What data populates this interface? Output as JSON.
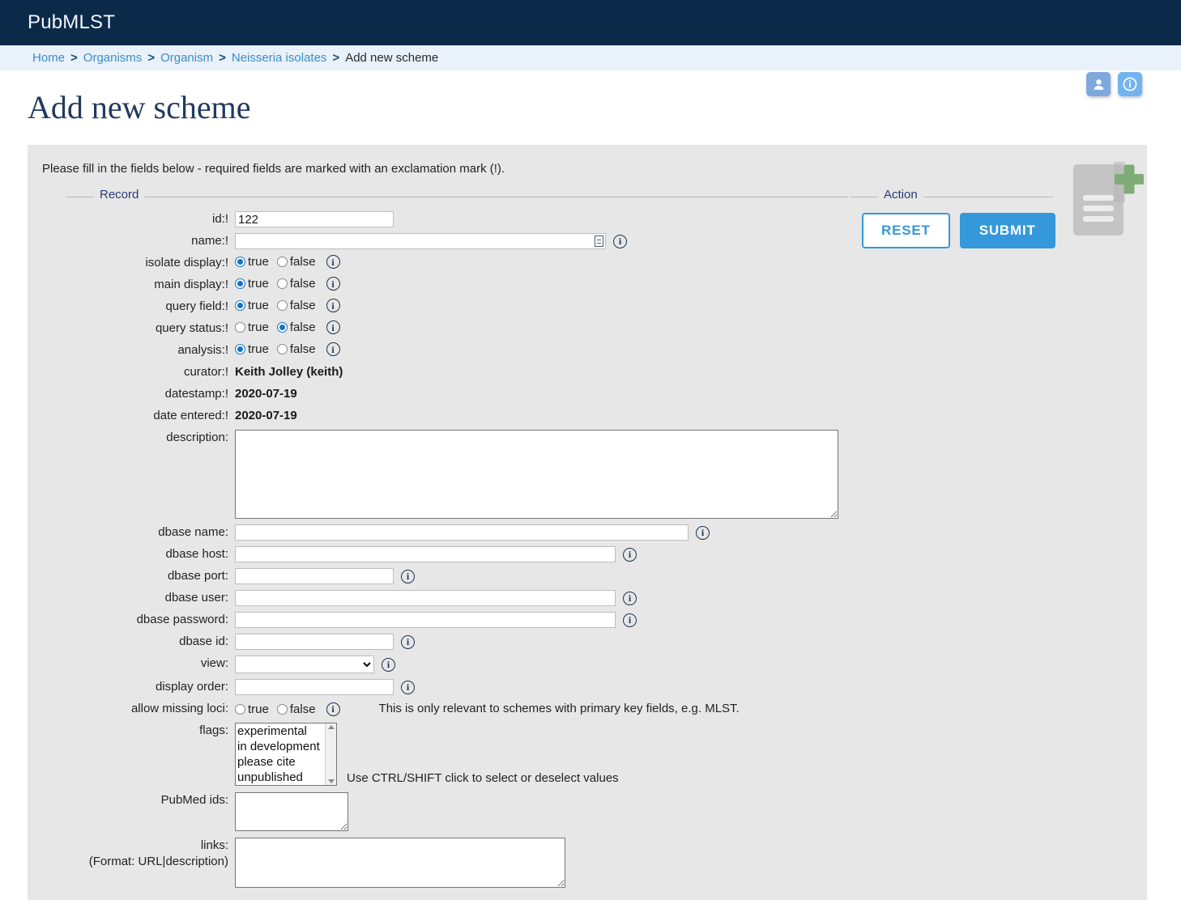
{
  "header": {
    "brand": "PubMLST"
  },
  "breadcrumb": {
    "separator": ">",
    "items": [
      {
        "label": "Home",
        "current": false
      },
      {
        "label": "Organisms",
        "current": false
      },
      {
        "label": "Organism",
        "current": false
      },
      {
        "label": "Neisseria isolates",
        "current": false
      },
      {
        "label": "Add new scheme",
        "current": true
      }
    ]
  },
  "icon_buttons": [
    {
      "name": "user-icon",
      "color": "#7fa8dd"
    },
    {
      "name": "info-icon",
      "color": "#74b4ee"
    }
  ],
  "page": {
    "title": "Add new scheme",
    "intro": "Please fill in the fields below - required fields are marked with an exclamation mark (!)."
  },
  "fieldsets": {
    "record_legend": "Record",
    "action_legend": "Action"
  },
  "action": {
    "reset_label": "RESET",
    "submit_label": "SUBMIT",
    "reset_color": "#3498db",
    "submit_color": "#3498db"
  },
  "form": {
    "id": {
      "label": "id:!",
      "value": "122"
    },
    "name": {
      "label": "name:!",
      "value": "",
      "placeholder": ""
    },
    "isolate_display": {
      "label": "isolate display:!",
      "true_label": "true",
      "false_label": "false",
      "value": "true"
    },
    "main_display": {
      "label": "main display:!",
      "true_label": "true",
      "false_label": "false",
      "value": "true"
    },
    "query_field": {
      "label": "query field:!",
      "true_label": "true",
      "false_label": "false",
      "value": "true"
    },
    "query_status": {
      "label": "query status:!",
      "true_label": "true",
      "false_label": "false",
      "value": "false"
    },
    "analysis": {
      "label": "analysis:!",
      "true_label": "true",
      "false_label": "false",
      "value": "true"
    },
    "curator": {
      "label": "curator:!",
      "value": "Keith Jolley (keith)"
    },
    "datestamp": {
      "label": "datestamp:!",
      "value": "2020-07-19"
    },
    "date_entered": {
      "label": "date entered:!",
      "value": "2020-07-19"
    },
    "description": {
      "label": "description:",
      "value": ""
    },
    "dbase_name": {
      "label": "dbase name:",
      "value": ""
    },
    "dbase_host": {
      "label": "dbase host:",
      "value": ""
    },
    "dbase_port": {
      "label": "dbase port:",
      "value": ""
    },
    "dbase_user": {
      "label": "dbase user:",
      "value": ""
    },
    "dbase_password": {
      "label": "dbase password:",
      "value": ""
    },
    "dbase_id": {
      "label": "dbase id:",
      "value": ""
    },
    "view": {
      "label": "view:",
      "value": "",
      "options": [
        ""
      ]
    },
    "display_order": {
      "label": "display order:",
      "value": ""
    },
    "allow_missing_loci": {
      "label": "allow missing loci:",
      "true_label": "true",
      "false_label": "false",
      "value": "",
      "note": "This is only relevant to schemes with primary key fields, e.g. MLST."
    },
    "flags": {
      "label": "flags:",
      "options": [
        "experimental",
        "in development",
        "please cite",
        "unpublished"
      ],
      "selected": [],
      "hint": "Use CTRL/SHIFT click to select or deselect values"
    },
    "pubmed_ids": {
      "label": "PubMed ids:",
      "value": ""
    },
    "links": {
      "label": "links:",
      "sublabel": "(Format: URL|description)",
      "value": ""
    }
  }
}
